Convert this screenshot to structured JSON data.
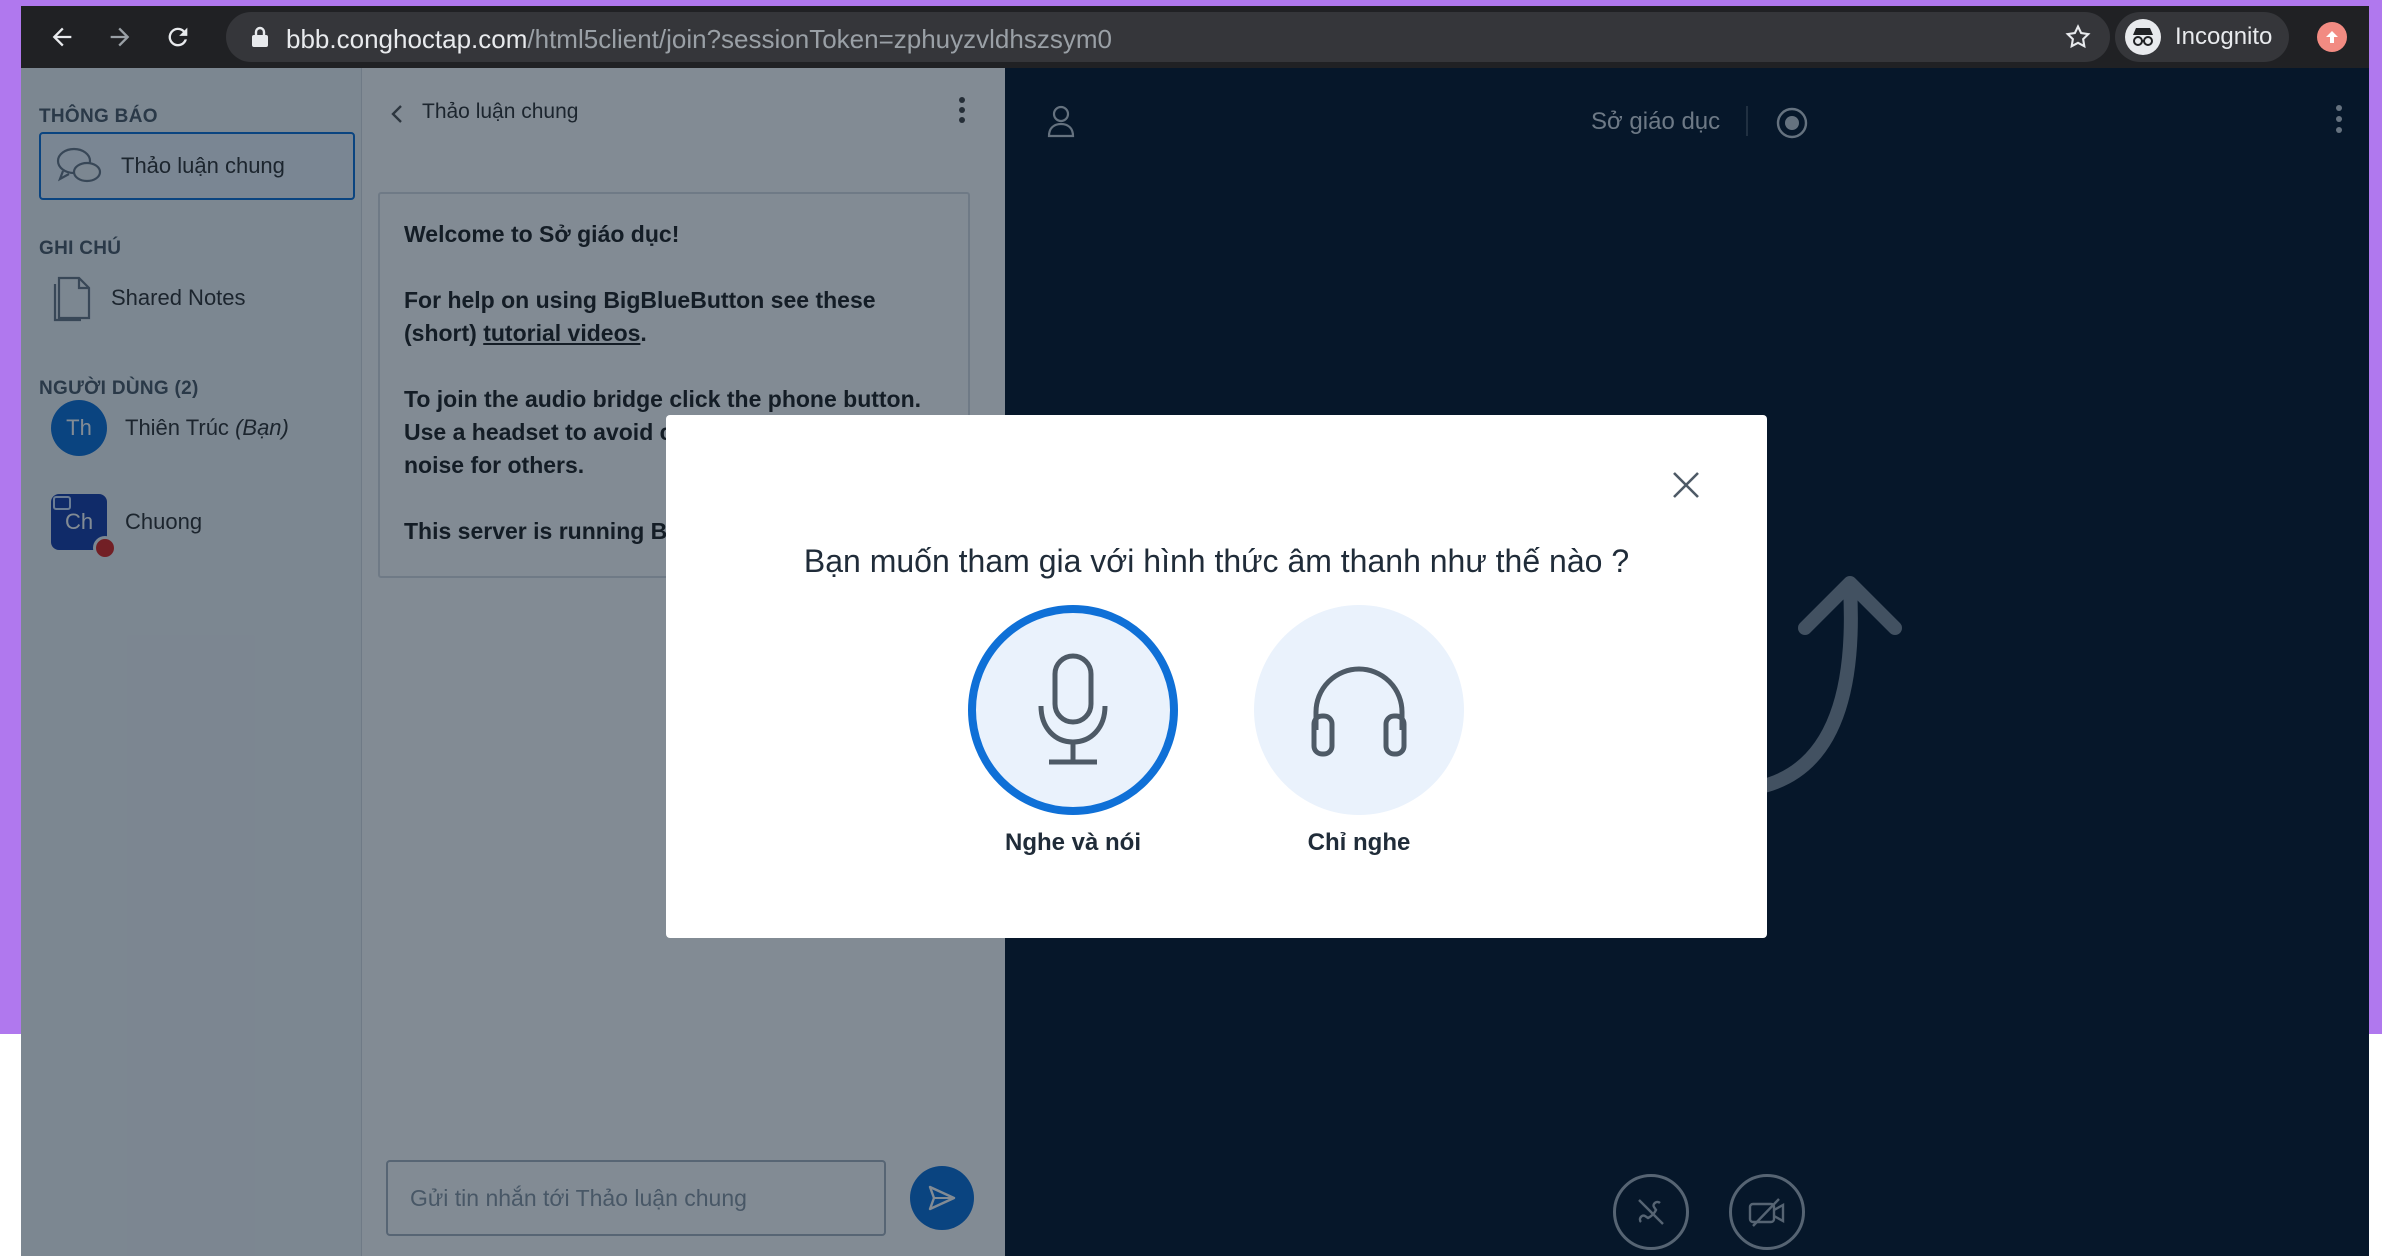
{
  "browser": {
    "url_host": "bbb.conghoctap.com",
    "url_path": "/html5client/join?sessionToken=zphuyzvldhszsym0",
    "profile_label": "Incognito"
  },
  "userlist": {
    "messages_title": "THÔNG BÁO",
    "public_chat": "Thảo luận chung",
    "notes_title": "GHI CHÚ",
    "shared_notes": "Shared Notes",
    "users_title": "NGƯỜI DÙNG (2)",
    "users": [
      {
        "initials": "Th",
        "name": "Thiên Trúc",
        "you_tag": "(Bạn)"
      },
      {
        "initials": "Ch",
        "name": "Chuong"
      }
    ]
  },
  "chat": {
    "header_title": "Thảo luận chung",
    "welcome_1a": "Welcome to ",
    "welcome_1b": "Sở giáo dục",
    "welcome_1c": "!",
    "help_a": "For help on using BigBlueButton see these (short) ",
    "help_link": "tutorial videos",
    "help_b": ".",
    "audio_text": "To join the audio bridge click the phone button. Use a headset to avoid causing background noise for others.",
    "server_text": "This server is running BigBlueButton.",
    "input_placeholder": "Gửi tin nhắn tới Thảo luận chung"
  },
  "main": {
    "meeting_name": "Sở giáo dục"
  },
  "modal": {
    "title": "Bạn muốn tham gia với hình thức âm thanh như thế nào ?",
    "option_mic": "Nghe và nói",
    "option_listen": "Chỉ nghe"
  },
  "colors": {
    "accent": "#0f70d7",
    "main_bg": "#06172a"
  }
}
